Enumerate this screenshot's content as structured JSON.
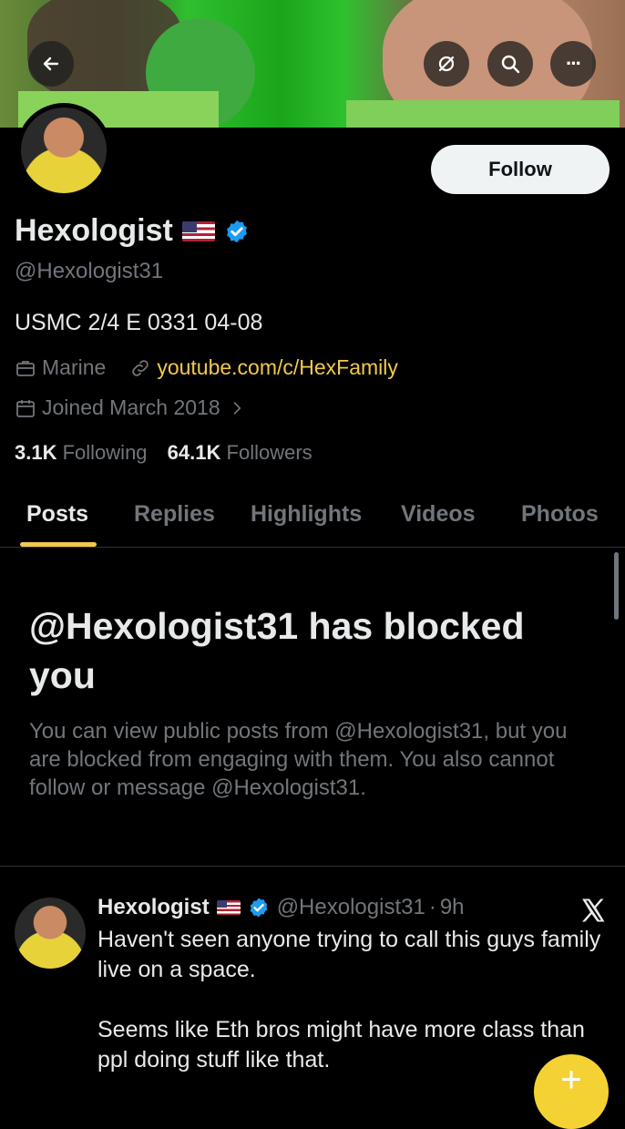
{
  "profile": {
    "name": "Hexologist",
    "handle": "@Hexologist31",
    "bio": "USMC 2/4 E 0331 04-08",
    "profession": "Marine",
    "link": "youtube.com/c/HexFamily",
    "joined": "Joined March 2018",
    "following_count": "3.1K",
    "following_label": "Following",
    "followers_count": "64.1K",
    "followers_label": "Followers"
  },
  "header": {
    "follow_label": "Follow",
    "more_label": "···"
  },
  "tabs": [
    {
      "label": "Posts",
      "active": true
    },
    {
      "label": "Replies",
      "active": false
    },
    {
      "label": "Highlights",
      "active": false
    },
    {
      "label": "Videos",
      "active": false
    },
    {
      "label": "Photos",
      "active": false
    }
  ],
  "blocked": {
    "title": "@Hexologist31 has blocked you",
    "message": "You can view public posts from @Hexologist31, but you are blocked from engaging with them. You also cannot follow or message @Hexologist31."
  },
  "tweet": {
    "name": "Hexologist",
    "handle": "@Hexologist31",
    "separator": "·",
    "time": "9h",
    "text": "Haven't seen anyone trying to call this guys family live on a space.\n\nSeems like Eth bros might have more class than ppl doing stuff like that."
  },
  "fab": {
    "label": "+"
  },
  "colors": {
    "accent": "#f2c94c",
    "verified": "#1d9bf0",
    "text_secondary": "#71767b",
    "fab": "#f5d234"
  },
  "icons": [
    "back-arrow-icon",
    "no-notifications-icon",
    "search-icon",
    "more-icon",
    "verified-badge-icon",
    "briefcase-icon",
    "link-icon",
    "calendar-icon",
    "chevron-right-icon",
    "x-logo-icon",
    "plus-icon"
  ]
}
